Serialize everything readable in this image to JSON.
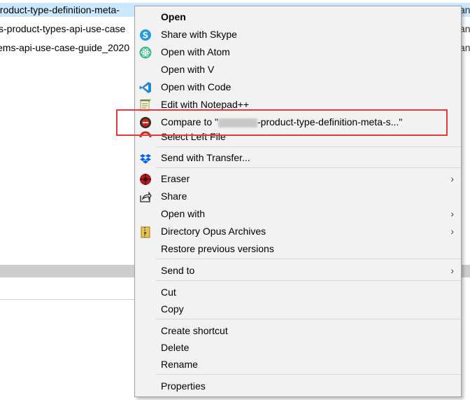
{
  "explorer": {
    "files": [
      {
        "name": "product-type-definition-meta-",
        "selected": true
      },
      {
        "name": "s-product-types-api-use-case",
        "selected": false
      },
      {
        "name": "ems-api-use-case-guide_2020",
        "selected": false
      }
    ],
    "row_tail": "an"
  },
  "menu": {
    "items": [
      {
        "key": "open",
        "label": "Open",
        "icon": "none",
        "bold": true
      },
      {
        "key": "skype",
        "label": "Share with Skype",
        "icon": "skype-icon"
      },
      {
        "key": "atom",
        "label": "Open with Atom",
        "icon": "atom-icon"
      },
      {
        "key": "v",
        "label": "Open with V",
        "icon": "none"
      },
      {
        "key": "code",
        "label": "Open with Code",
        "icon": "vscode-icon"
      },
      {
        "key": "notepad",
        "label": "Edit with Notepad++",
        "icon": "notepad-plus-plus-icon"
      },
      {
        "key": "compare",
        "label_prefix": "Compare to \"",
        "label_suffix": "-product-type-definition-meta-s...\"",
        "icon": "compare-icon"
      },
      {
        "key": "selectleft",
        "label": "Select Left File",
        "icon": "compare-left-icon"
      },
      {
        "key": "transfer",
        "label": "Send with Transfer...",
        "icon": "dropbox-icon"
      },
      {
        "key": "eraser",
        "label": "Eraser",
        "icon": "eraser-icon",
        "submenu": true
      },
      {
        "key": "share",
        "label": "Share",
        "icon": "share-icon"
      },
      {
        "key": "openwith",
        "label": "Open with",
        "icon": "none",
        "submenu": true
      },
      {
        "key": "dopus",
        "label": "Directory Opus Archives",
        "icon": "archive-icon",
        "submenu": true
      },
      {
        "key": "restore",
        "label": "Restore previous versions",
        "icon": "none"
      },
      {
        "key": "sendto",
        "label": "Send to",
        "icon": "none",
        "submenu": true
      },
      {
        "key": "cut",
        "label": "Cut",
        "icon": "none"
      },
      {
        "key": "copy",
        "label": "Copy",
        "icon": "none"
      },
      {
        "key": "shortcut",
        "label": "Create shortcut",
        "icon": "none"
      },
      {
        "key": "delete",
        "label": "Delete",
        "icon": "none"
      },
      {
        "key": "rename",
        "label": "Rename",
        "icon": "none"
      },
      {
        "key": "properties",
        "label": "Properties",
        "icon": "none"
      }
    ],
    "submenu_arrow": "›"
  },
  "colors": {
    "highlight_box": "#e0393e",
    "selection": "#cce8ff",
    "menu_bg": "#f2f2f2"
  }
}
